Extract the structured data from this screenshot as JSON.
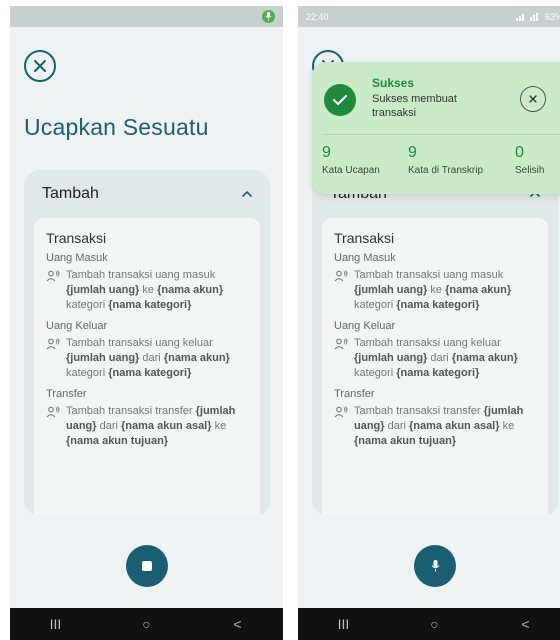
{
  "left": {
    "page_title": "Ucapkan Sesuatu",
    "card_header": "Tambah",
    "section_title": "Transaksi",
    "groups": [
      {
        "label": "Uang Masuk",
        "cmd": [
          {
            "t": "Tambah transaksi uang masuk ",
            "b": false
          },
          {
            "t": "{jumlah uang}",
            "b": true
          },
          {
            "t": " ke ",
            "b": false
          },
          {
            "t": "{nama akun}",
            "b": true
          },
          {
            "t": " kategori ",
            "b": false
          },
          {
            "t": "{nama kategori}",
            "b": true
          }
        ]
      },
      {
        "label": "Uang Keluar",
        "cmd": [
          {
            "t": "Tambah transaksi uang keluar ",
            "b": false
          },
          {
            "t": "{jumlah uang}",
            "b": true
          },
          {
            "t": " dari ",
            "b": false
          },
          {
            "t": "{nama akun}",
            "b": true
          },
          {
            "t": " kategori ",
            "b": false
          },
          {
            "t": "{nama kategori}",
            "b": true
          }
        ]
      },
      {
        "label": "Transfer",
        "cmd": [
          {
            "t": "Tambah transaksi transfer ",
            "b": false
          },
          {
            "t": "{jumlah uang}",
            "b": true
          },
          {
            "t": " dari ",
            "b": false
          },
          {
            "t": "{nama akun asal}",
            "b": true
          },
          {
            "t": " ke ",
            "b": false
          },
          {
            "t": "{nama akun tujuan}",
            "b": true
          }
        ]
      }
    ],
    "nav": [
      "III",
      "○",
      "<"
    ]
  },
  "right": {
    "status_time": "22:40",
    "status_right": "63%",
    "card_header": "Tambah",
    "section_title": "Transaksi",
    "toast": {
      "title": "Sukses",
      "message": "Sukses membuat transaksi",
      "stats": [
        {
          "num": "9",
          "label": "Kata Ucapan"
        },
        {
          "num": "9",
          "label": "Kata di Transkrip"
        },
        {
          "num": "0",
          "label": "Selisih"
        }
      ]
    }
  },
  "colors": {
    "primary": "#1b5e73",
    "success": "#1f8a3b",
    "toast_bg": "#c9ebc7"
  },
  "icons": [
    "close-icon",
    "chevron-up-icon",
    "voice-command-icon",
    "stop-icon",
    "mic-icon",
    "check-icon"
  ]
}
